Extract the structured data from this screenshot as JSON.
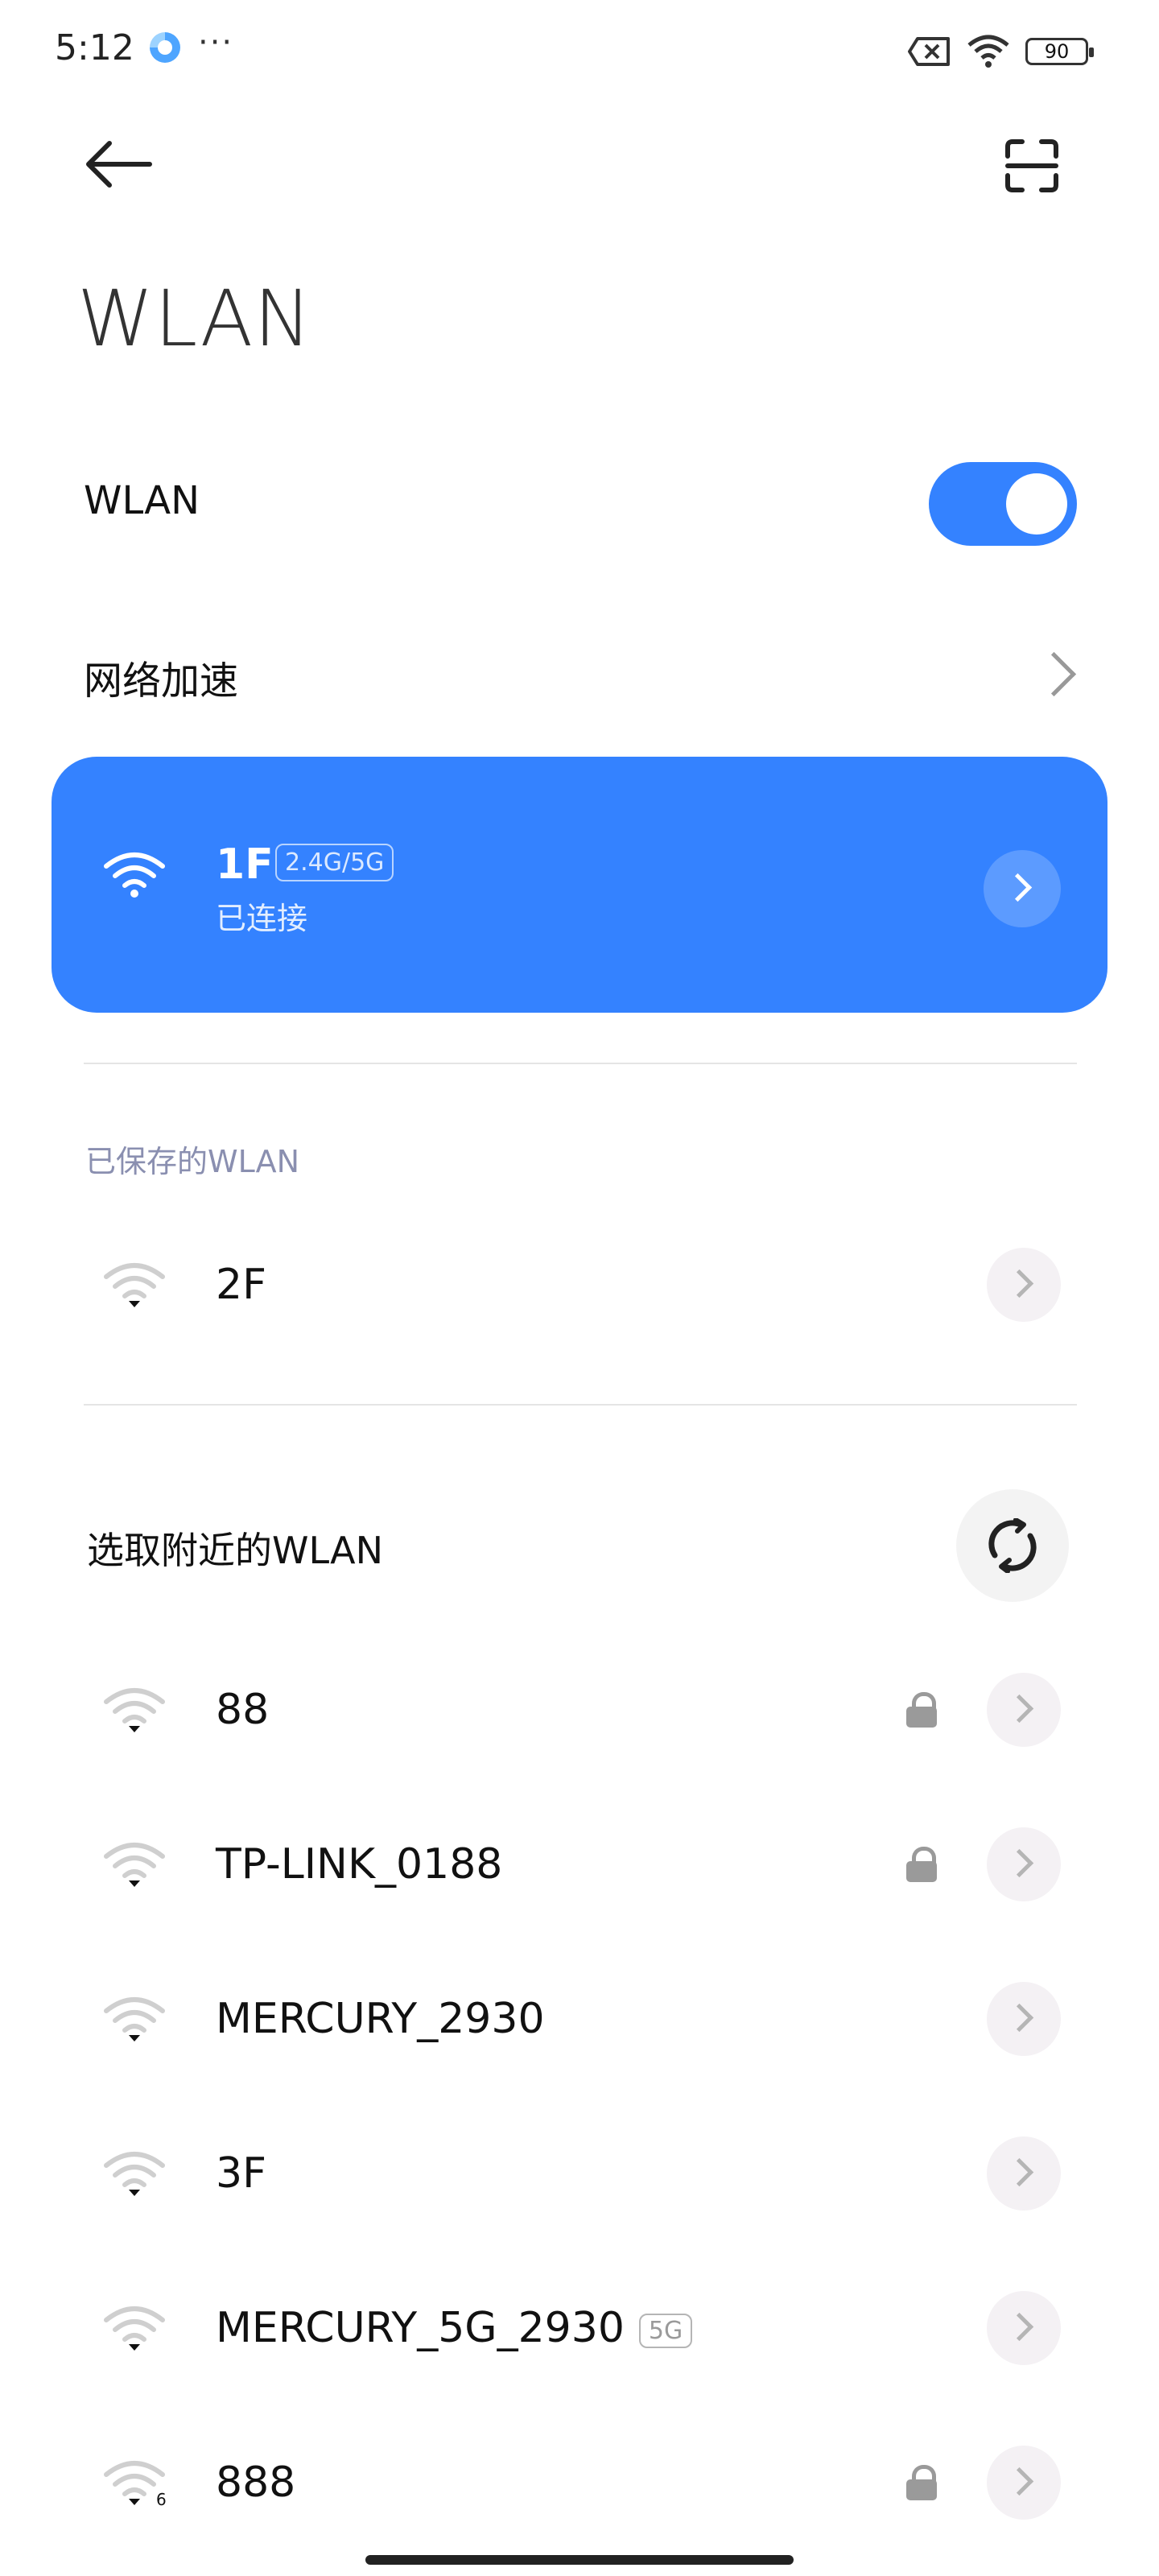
{
  "status_bar": {
    "time": "5:12",
    "dots": "···",
    "battery": "90"
  },
  "header": {
    "title": "WLAN"
  },
  "wlan_toggle": {
    "label": "WLAN",
    "on": true
  },
  "acceleration": {
    "label": "网络加速"
  },
  "connected": {
    "name": "1F",
    "band": "2.4G/5G",
    "status": "已连接"
  },
  "saved": {
    "header": "已保存的WLAN",
    "networks": [
      {
        "name": "2F"
      }
    ]
  },
  "nearby": {
    "header": "选取附近的WLAN",
    "networks": [
      {
        "name": "88",
        "locked": true,
        "badge": ""
      },
      {
        "name": "TP-LINK_0188",
        "locked": true,
        "badge": ""
      },
      {
        "name": "MERCURY_2930",
        "locked": false,
        "badge": ""
      },
      {
        "name": "3F",
        "locked": false,
        "badge": ""
      },
      {
        "name": "MERCURY_5G_2930",
        "locked": false,
        "badge": "5G"
      },
      {
        "name": "888",
        "locked": true,
        "badge": "",
        "wifi_standard": "6"
      }
    ]
  },
  "colors": {
    "accent": "#3482ff",
    "muted_text": "#8a8fb0",
    "icon_gray": "#9a9a9a"
  }
}
